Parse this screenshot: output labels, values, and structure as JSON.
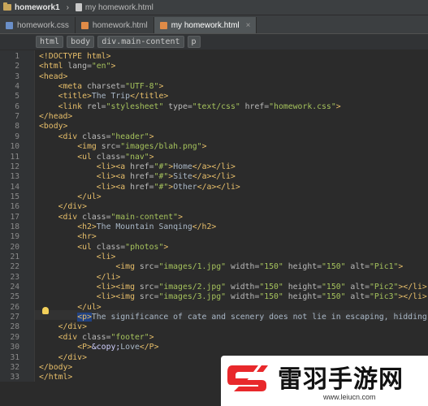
{
  "breadcrumb": {
    "project": "homework1",
    "file": "my homework.html"
  },
  "tabs": [
    {
      "label": "homework.css",
      "icon_color": "#6a8fc8",
      "active": false,
      "closable": false
    },
    {
      "label": "homework.html",
      "icon_color": "#e08b47",
      "active": false,
      "closable": false
    },
    {
      "label": "my homework.html",
      "icon_color": "#e08b47",
      "active": true,
      "closable": true
    }
  ],
  "close_glyph": "×",
  "path": [
    "html",
    "body",
    "div.main-content",
    "p"
  ],
  "line_numbers": [
    "1",
    "2",
    "3",
    "4",
    "5",
    "6",
    "7",
    "8",
    "9",
    "10",
    "11",
    "12",
    "13",
    "14",
    "15",
    "16",
    "17",
    "18",
    "19",
    "20",
    "21",
    "22",
    "23",
    "24",
    "25",
    "26",
    "27",
    "28",
    "29",
    "30",
    "31",
    "32",
    "33"
  ],
  "code_lines": [
    [
      [
        "t",
        "<!DOCTYPE html>"
      ]
    ],
    [
      [
        "t",
        "<html "
      ],
      [
        "a",
        "lang="
      ],
      [
        "v",
        "\"en\""
      ],
      [
        "t",
        ">"
      ]
    ],
    [
      [
        "t",
        "<head>"
      ]
    ],
    [
      [
        "p",
        "    "
      ],
      [
        "t",
        "<meta "
      ],
      [
        "a",
        "charset="
      ],
      [
        "v",
        "\"UTF-8\""
      ],
      [
        "t",
        ">"
      ]
    ],
    [
      [
        "p",
        "    "
      ],
      [
        "t",
        "<title>"
      ],
      [
        "p",
        "The Trip"
      ],
      [
        "t",
        "</title>"
      ]
    ],
    [
      [
        "p",
        "    "
      ],
      [
        "t",
        "<link "
      ],
      [
        "a",
        "rel="
      ],
      [
        "v",
        "\"stylesheet\" "
      ],
      [
        "a",
        "type="
      ],
      [
        "v",
        "\"text/css\" "
      ],
      [
        "a",
        "href="
      ],
      [
        "v",
        "\"homework.css\""
      ],
      [
        "t",
        ">"
      ]
    ],
    [
      [
        "t",
        "</head>"
      ]
    ],
    [
      [
        "t",
        "<body>"
      ]
    ],
    [
      [
        "p",
        "    "
      ],
      [
        "t",
        "<div "
      ],
      [
        "a",
        "class="
      ],
      [
        "v",
        "\"header\""
      ],
      [
        "t",
        ">"
      ]
    ],
    [
      [
        "p",
        "        "
      ],
      [
        "t",
        "<img "
      ],
      [
        "a",
        "src="
      ],
      [
        "v",
        "\"images/blah.png\""
      ],
      [
        "t",
        ">"
      ]
    ],
    [
      [
        "p",
        "        "
      ],
      [
        "t",
        "<ul "
      ],
      [
        "a",
        "class="
      ],
      [
        "v",
        "\"nav\""
      ],
      [
        "t",
        ">"
      ]
    ],
    [
      [
        "p",
        "            "
      ],
      [
        "t",
        "<li><a "
      ],
      [
        "a",
        "href="
      ],
      [
        "v",
        "\"#\""
      ],
      [
        "t",
        ">"
      ],
      [
        "p",
        "Home"
      ],
      [
        "t",
        "</a></li>"
      ]
    ],
    [
      [
        "p",
        "            "
      ],
      [
        "t",
        "<li><a "
      ],
      [
        "a",
        "href="
      ],
      [
        "v",
        "\"#\""
      ],
      [
        "t",
        ">"
      ],
      [
        "p",
        "Site"
      ],
      [
        "t",
        "</a></li>"
      ]
    ],
    [
      [
        "p",
        "            "
      ],
      [
        "t",
        "<li><a "
      ],
      [
        "a",
        "href="
      ],
      [
        "v",
        "\"#\""
      ],
      [
        "t",
        ">"
      ],
      [
        "p",
        "Other"
      ],
      [
        "t",
        "</a></li>"
      ]
    ],
    [
      [
        "p",
        "        "
      ],
      [
        "t",
        "</ul>"
      ]
    ],
    [
      [
        "p",
        "    "
      ],
      [
        "t",
        "</div>"
      ]
    ],
    [
      [
        "p",
        "    "
      ],
      [
        "t",
        "<div "
      ],
      [
        "a",
        "class="
      ],
      [
        "v",
        "\"main-content\""
      ],
      [
        "t",
        ">"
      ]
    ],
    [
      [
        "p",
        "        "
      ],
      [
        "t",
        "<h2>"
      ],
      [
        "p",
        "The Mountain Sanqing"
      ],
      [
        "t",
        "</h2>"
      ]
    ],
    [
      [
        "p",
        "        "
      ],
      [
        "t",
        "<hr>"
      ]
    ],
    [
      [
        "p",
        "        "
      ],
      [
        "t",
        "<ul "
      ],
      [
        "a",
        "class="
      ],
      [
        "v",
        "\"photos\""
      ],
      [
        "t",
        ">"
      ]
    ],
    [
      [
        "p",
        "            "
      ],
      [
        "t",
        "<li>"
      ]
    ],
    [
      [
        "p",
        "                "
      ],
      [
        "t",
        "<img "
      ],
      [
        "a",
        "src="
      ],
      [
        "v",
        "\"images/1.jpg\" "
      ],
      [
        "a",
        "width="
      ],
      [
        "v",
        "\"150\" "
      ],
      [
        "a",
        "height="
      ],
      [
        "v",
        "\"150\" "
      ],
      [
        "a",
        "alt="
      ],
      [
        "v",
        "\"Pic1\""
      ],
      [
        "t",
        ">"
      ]
    ],
    [
      [
        "p",
        "            "
      ],
      [
        "t",
        "</li>"
      ]
    ],
    [
      [
        "p",
        "            "
      ],
      [
        "t",
        "<li><img "
      ],
      [
        "a",
        "src="
      ],
      [
        "v",
        "\"images/2.jpg\" "
      ],
      [
        "a",
        "width="
      ],
      [
        "v",
        "\"150\" "
      ],
      [
        "a",
        "height="
      ],
      [
        "v",
        "\"150\" "
      ],
      [
        "a",
        "alt="
      ],
      [
        "v",
        "\"Pic2\""
      ],
      [
        "t",
        "></li>"
      ]
    ],
    [
      [
        "p",
        "            "
      ],
      [
        "t",
        "<li><img "
      ],
      [
        "a",
        "src="
      ],
      [
        "v",
        "\"images/3.jpg\" "
      ],
      [
        "a",
        "width="
      ],
      [
        "v",
        "\"150\" "
      ],
      [
        "a",
        "height="
      ],
      [
        "v",
        "\"150\" "
      ],
      [
        "a",
        "alt="
      ],
      [
        "v",
        "\"Pic3\""
      ],
      [
        "t",
        "></li>"
      ]
    ],
    [
      [
        "p",
        "        "
      ],
      [
        "t",
        "</ul>"
      ]
    ],
    [
      [
        "p",
        "        "
      ],
      [
        "s",
        "<p>"
      ],
      [
        "p",
        "The significance of cate and scenery does not lie in escaping, hidding, o"
      ]
    ],
    [
      [
        "p",
        "    "
      ],
      [
        "t",
        "</div>"
      ]
    ],
    [
      [
        "p",
        "    "
      ],
      [
        "t",
        "<div "
      ],
      [
        "a",
        "class="
      ],
      [
        "v",
        "\"footer\""
      ],
      [
        "t",
        ">"
      ]
    ],
    [
      [
        "p",
        "        "
      ],
      [
        "t",
        "<P>"
      ],
      [
        "e",
        "&copy;"
      ],
      [
        "p",
        "Love"
      ],
      [
        "t",
        "</P>"
      ]
    ],
    [
      [
        "p",
        "    "
      ],
      [
        "t",
        "</div>"
      ]
    ],
    [
      [
        "t",
        "</body>"
      ]
    ],
    [
      [
        "t",
        "</html>"
      ]
    ]
  ],
  "watermark": {
    "title": "雷羽手游网",
    "url": "www.leiucn.com"
  }
}
